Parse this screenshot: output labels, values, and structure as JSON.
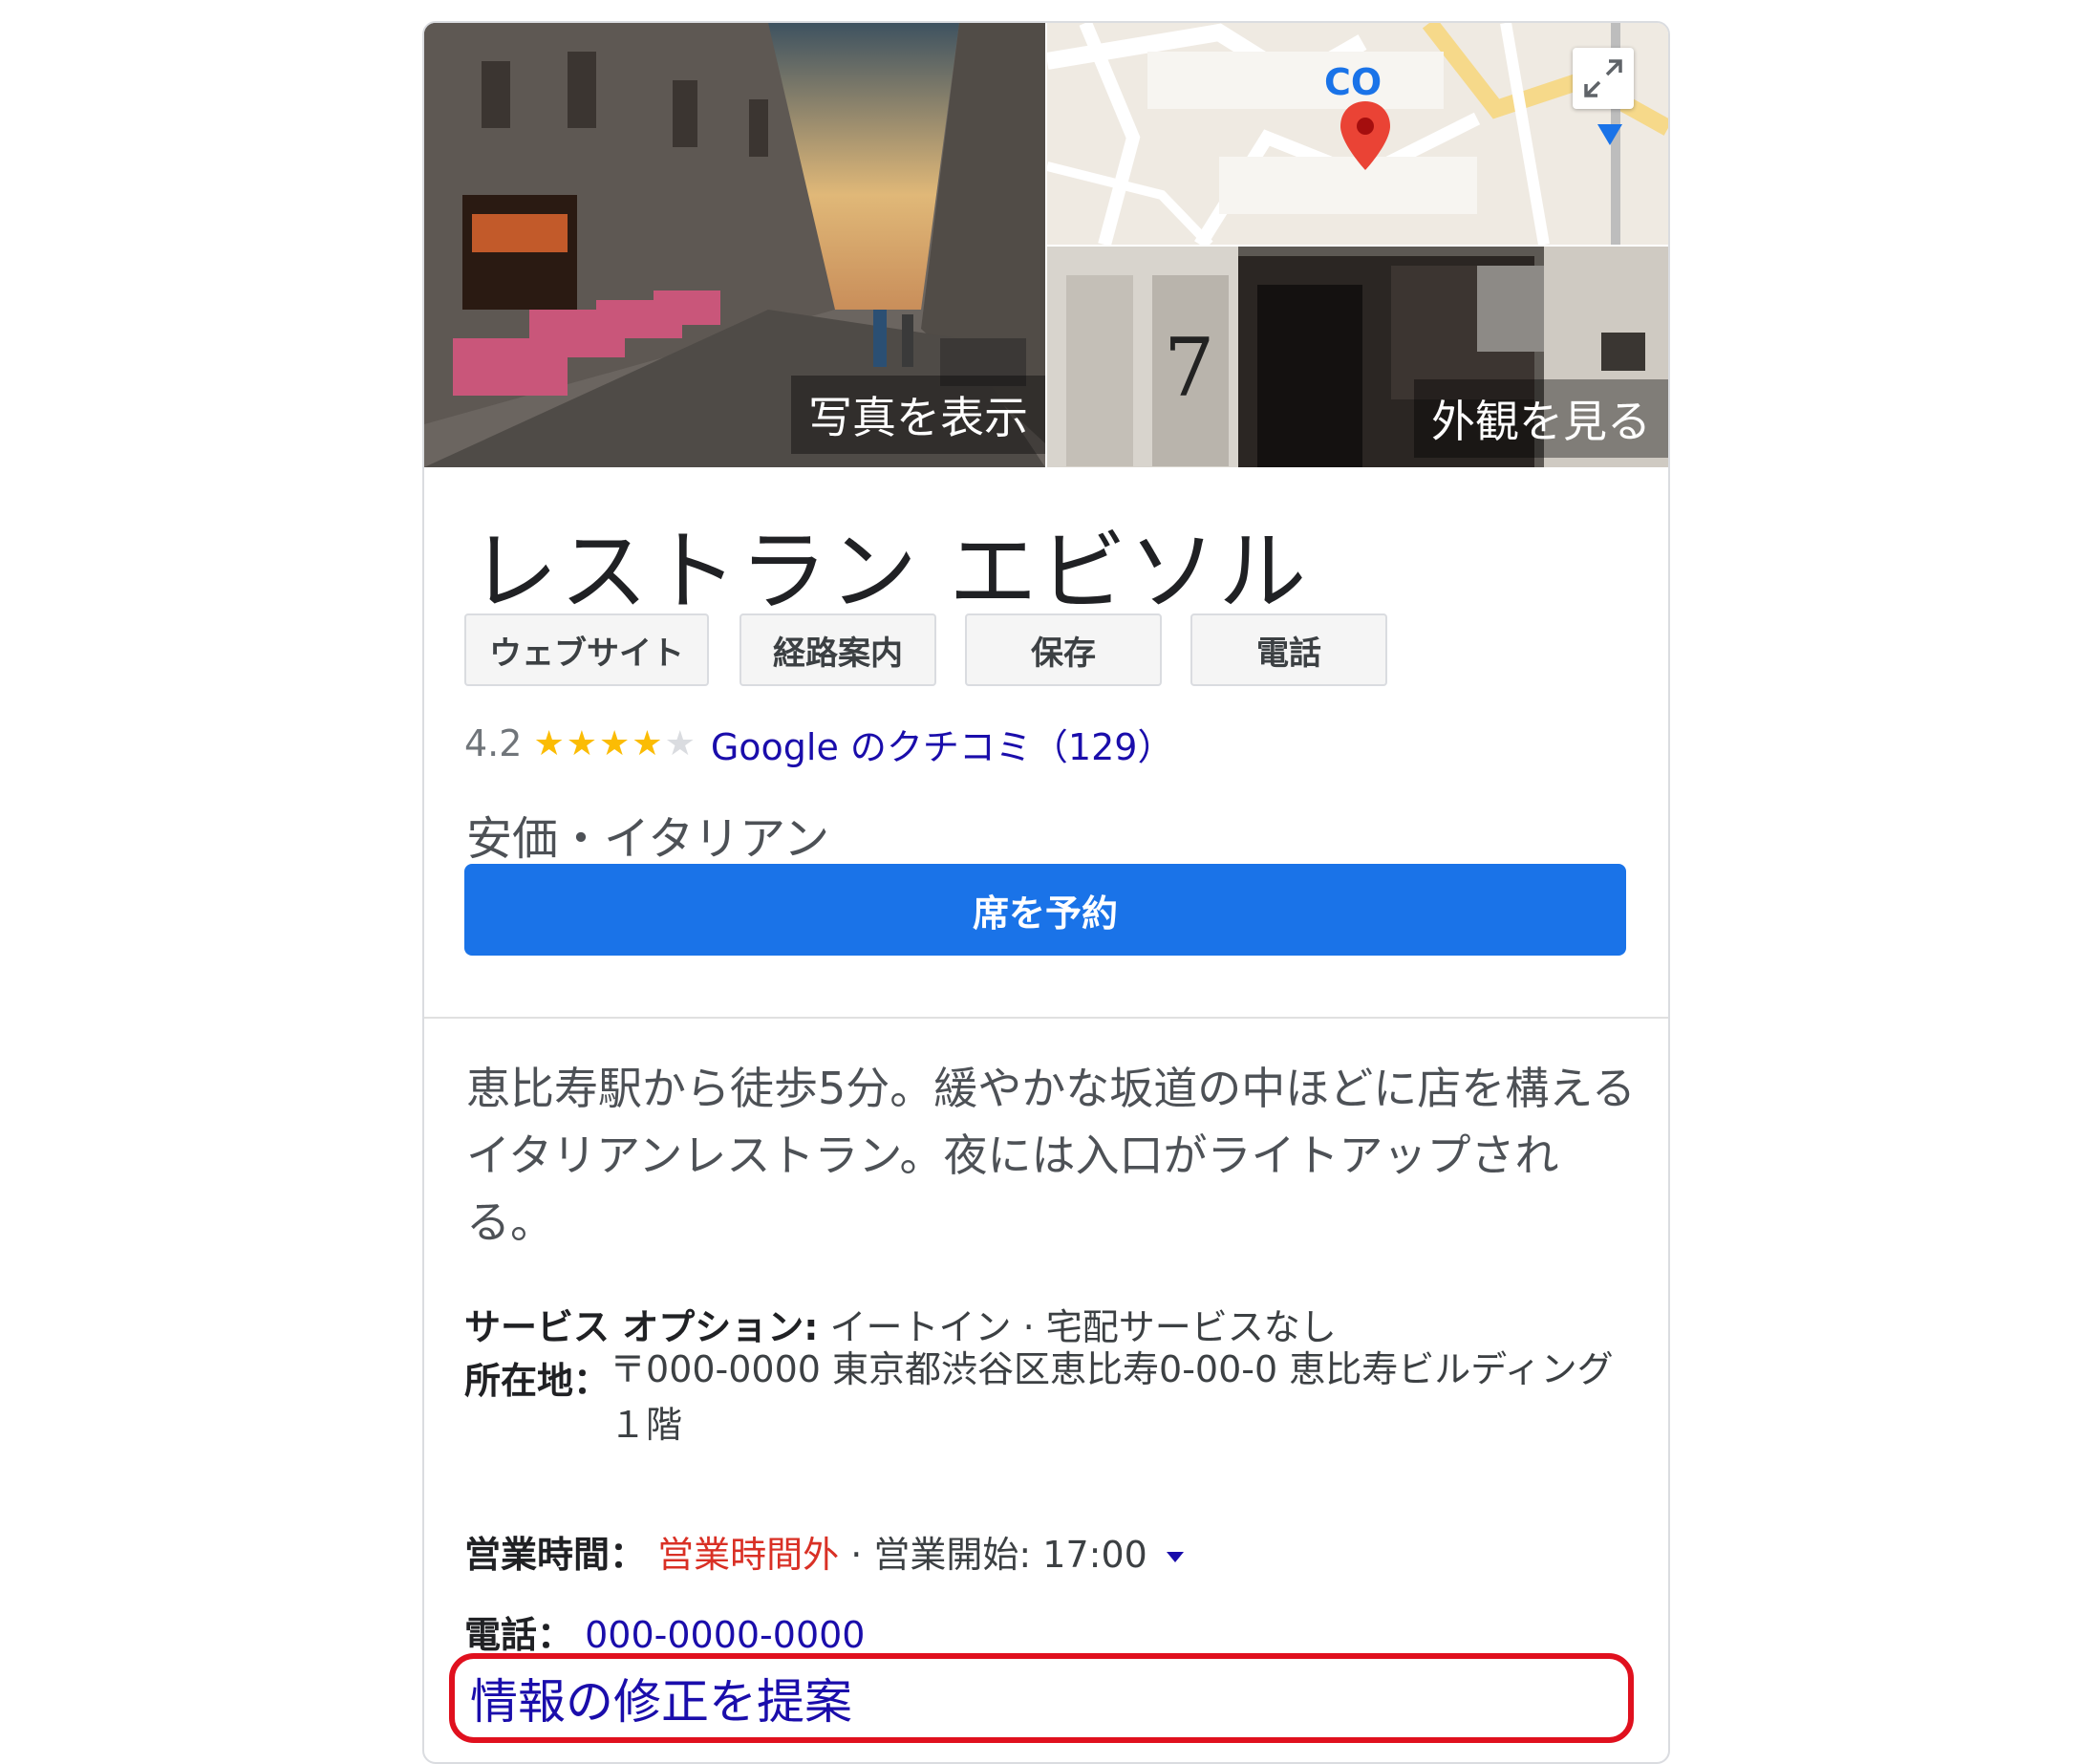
{
  "photos": {
    "left_label": "写真を表示",
    "right_label": "外観を見る",
    "map_text": "CO",
    "storefront_number": "7"
  },
  "place": {
    "title": "レストラン エビソル",
    "category": "安価・イタリアン"
  },
  "actions": [
    {
      "label": "ウェブサイト"
    },
    {
      "label": "経路案内"
    },
    {
      "label": "保存"
    },
    {
      "label": "電話"
    }
  ],
  "rating": {
    "value": "4.2",
    "stars": 4.2,
    "reviews_text": "Google のクチコミ（129）"
  },
  "reserve_label": "席を予約",
  "description": "恵比寿駅から徒歩5分。緩やかな坂道の中ほどに店を構えるイタリアンレストラン。夜には入口がライトアップされる。",
  "service": {
    "label": "サービス オプション:",
    "value": "イートイン · 宅配サービスなし"
  },
  "address": {
    "label": "所在地：",
    "value": "〒000-0000 東京都渋谷区恵比寿0-00-0 恵比寿ビルディング１階"
  },
  "hours": {
    "label": "営業時間：",
    "status": "営業時間外",
    "separator": "·",
    "open_text": "営業開始: 17:00"
  },
  "phone": {
    "label": "電話：",
    "number": "000-0000-0000"
  },
  "suggest_edit": "情報の修正を提案",
  "colors": {
    "primary": "#1a73e8",
    "link": "#1a0dab",
    "closed": "#d93025",
    "star": "#fbbc04",
    "highlight": "#e0101e"
  }
}
